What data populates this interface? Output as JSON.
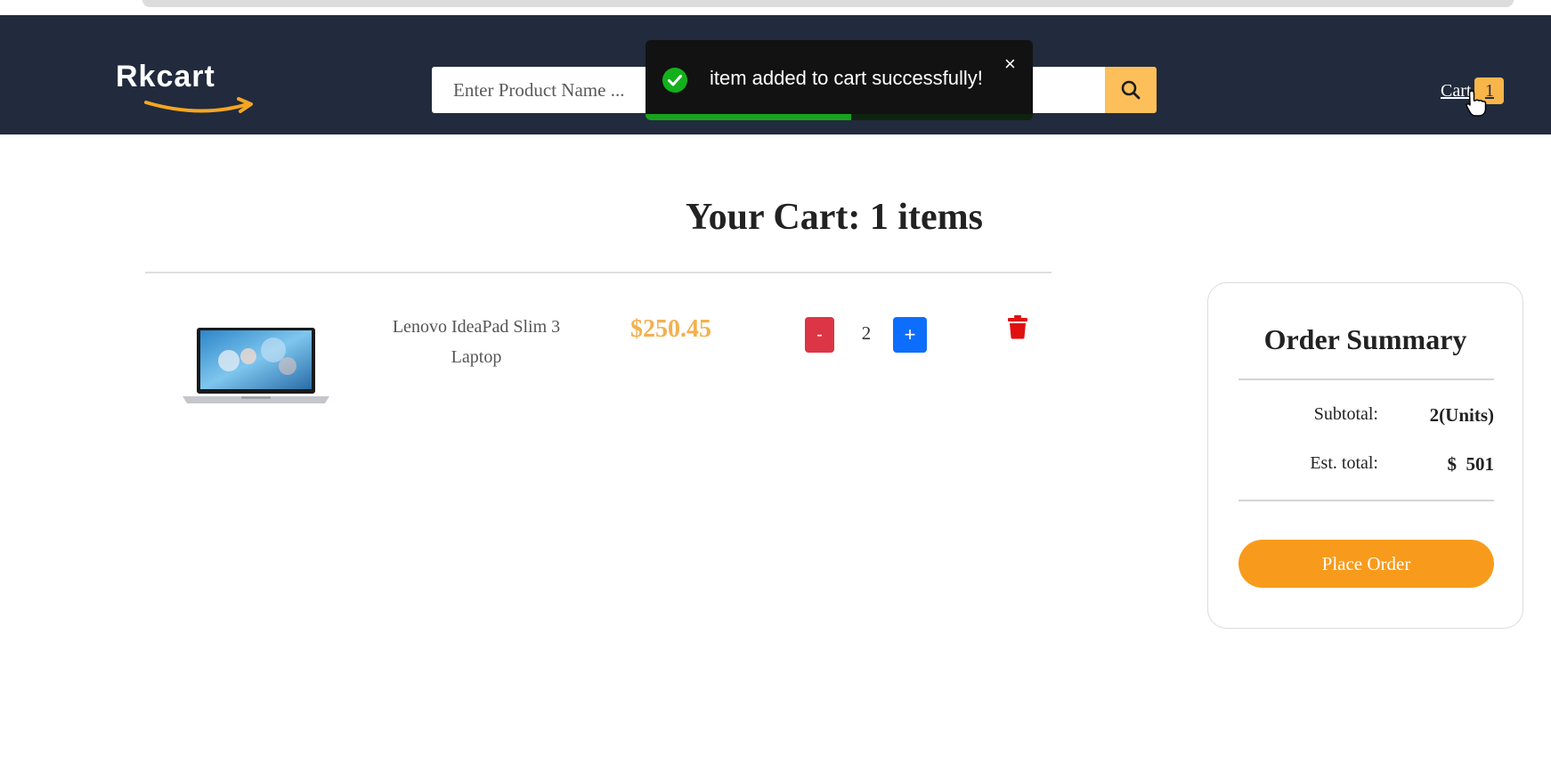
{
  "brand": {
    "name": "Rkcart"
  },
  "search": {
    "placeholder": "Enter Product Name ...",
    "icon": "search-icon"
  },
  "cart_link": {
    "label": "Cart",
    "count": "1"
  },
  "toast": {
    "message": "item added to cart successfully!",
    "close_symbol": "×",
    "progress": 0.53,
    "status": "success"
  },
  "cart": {
    "heading_prefix": "Your Cart: ",
    "heading_count": "1 items",
    "items": [
      {
        "name": "Lenovo IdeaPad Slim 3 Laptop",
        "price": "$250.45",
        "quantity": "2",
        "minus_label": "-",
        "plus_label": "+",
        "image": "laptop-image"
      }
    ]
  },
  "summary": {
    "title": "Order Summary",
    "subtotal_label": "Subtotal:",
    "subtotal_value": "2(Units)",
    "total_label": "Est. total:",
    "total_value": "$  501",
    "place_order_label": "Place Order"
  },
  "colors": {
    "navbar": "#212b3d",
    "accent": "#fdbf5a",
    "price": "#f4b04f",
    "place_order": "#f89b1c",
    "minus": "#dc3545",
    "plus": "#0d6efd",
    "delete": "#e01010",
    "toast_success": "#18a21d"
  }
}
